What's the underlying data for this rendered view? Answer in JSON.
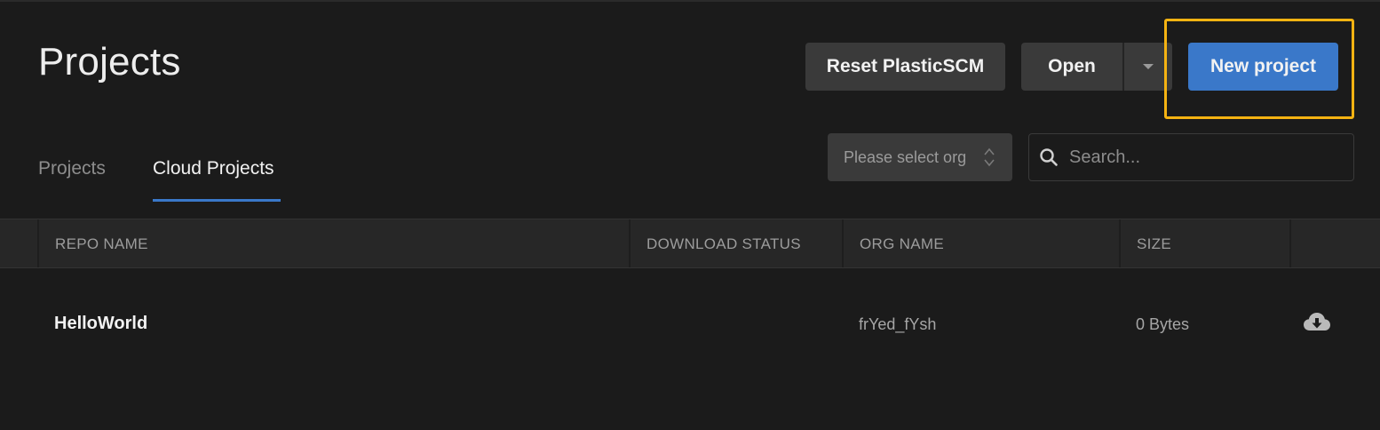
{
  "header": {
    "title": "Projects",
    "reset_label": "Reset PlasticSCM",
    "open_label": "Open",
    "new_project_label": "New project"
  },
  "tabs": [
    {
      "label": "Projects",
      "active": false
    },
    {
      "label": "Cloud Projects",
      "active": true
    }
  ],
  "filters": {
    "org_select_value": "Please select org",
    "search_placeholder": "Search..."
  },
  "table": {
    "columns": [
      "REPO NAME",
      "DOWNLOAD STATUS",
      "ORG NAME",
      "SIZE"
    ],
    "rows": [
      {
        "repo_name": "HelloWorld",
        "download_status": "",
        "org_name": "frYed_fYsh",
        "size": "0 Bytes"
      }
    ]
  },
  "colors": {
    "background": "#1b1b1b",
    "accent": "#3a78c9",
    "highlight": "#f5b312"
  },
  "icons": {
    "dropdown": "chevron-down-icon",
    "org_select": "updown-arrows-icon",
    "search": "search-icon",
    "download": "cloud-download-icon"
  }
}
